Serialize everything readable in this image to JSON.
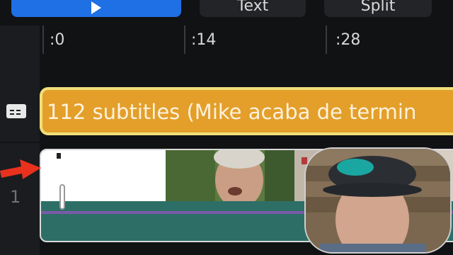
{
  "toolbar": {
    "text_label": "Text",
    "split_label": "Split"
  },
  "ruler": {
    "ticks": [
      ":0",
      ":14",
      ":28"
    ]
  },
  "subtitle_track": {
    "clip_label": "112 subtitles (Mike acaba de termin"
  },
  "video_track": {
    "number": "1"
  },
  "colors": {
    "accent": "#1f6fe5",
    "subtitle_clip": "#e39f2a",
    "subtitle_border": "#f1df7a",
    "video_clip": "#2d6f67",
    "audio_line": "#7a5aa8",
    "arrow": "#e8321e"
  },
  "icons": {
    "play": "play-icon",
    "subtitle": "subtitle-track-icon",
    "arrow": "red-arrow-annotation"
  }
}
